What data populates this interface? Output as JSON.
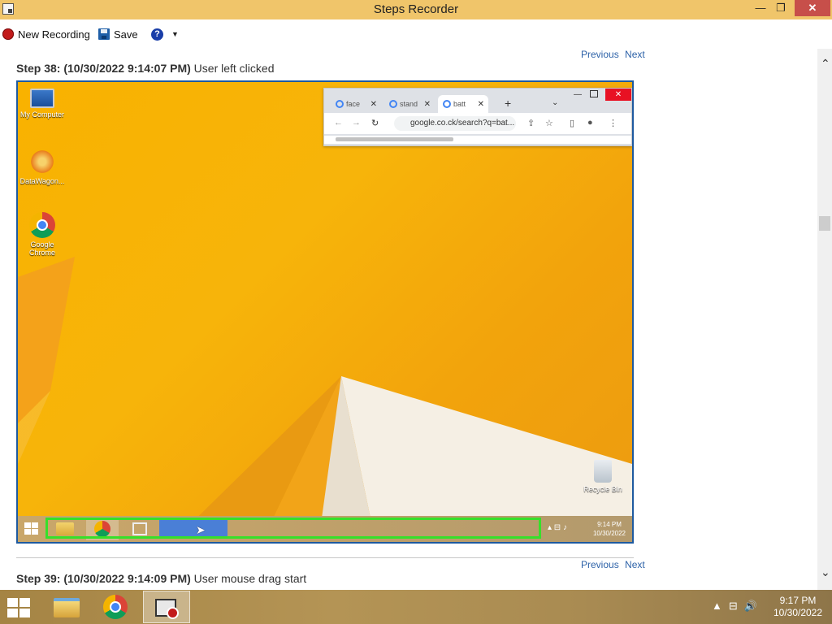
{
  "window": {
    "title": "Steps Recorder",
    "controls": {
      "minimize": "—",
      "maximize": "❐",
      "close": "✕"
    }
  },
  "toolbar": {
    "new_recording_label": "New Recording",
    "save_label": "Save",
    "help_icon": "?",
    "dropdown": "▼"
  },
  "steps": [
    {
      "nav": {
        "previous": "Previous",
        "next": "Next"
      },
      "label": "Step 38: (10/30/2022 9:14:07 PM)",
      "action": "User left clicked"
    },
    {
      "nav": {
        "previous": "Previous",
        "next": "Next"
      },
      "label": "Step 39: (10/30/2022 9:14:09 PM)",
      "action": "User mouse drag start"
    }
  ],
  "screenshot": {
    "desktop_icons": [
      "My Computer",
      "DataWagon...",
      "Google Chrome",
      "Recycle Bin"
    ],
    "browser": {
      "tabs": [
        "face",
        "stand",
        "batt"
      ],
      "tab_close": "✕",
      "new_tab": "+",
      "url": "google.co.ck/search?q=bat..."
    },
    "clock": {
      "time": "9:14 PM",
      "date": "10/30/2022"
    }
  },
  "taskbar": {
    "clock": {
      "time": "9:17 PM",
      "date": "10/30/2022"
    },
    "tray": [
      "▲",
      "⊟",
      "🔊"
    ]
  },
  "colors": {
    "titlebar": "#f0c56a",
    "link": "#2d62a8",
    "highlight": "#36e02a",
    "frame": "#1e5aa0"
  }
}
